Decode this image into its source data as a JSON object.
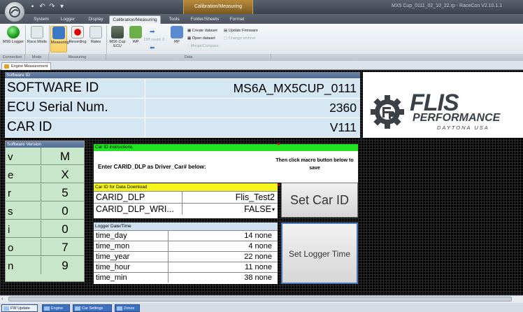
{
  "window": {
    "title": "MX5 Cup_0111_02_10_22.rp - RaceCon V2.10.1.1",
    "context_tab_caption": "Calibration/Measuring"
  },
  "ribbon": {
    "tabs": [
      {
        "label": "System",
        "active": false
      },
      {
        "label": "Logger",
        "active": false
      },
      {
        "label": "Display",
        "active": false
      },
      {
        "label": "Calibration/Measuring",
        "active": true
      },
      {
        "label": "Tools",
        "active": false
      },
      {
        "label": "Folder/Sheets",
        "active": false
      },
      {
        "label": "Format",
        "active": false
      }
    ],
    "buttons": {
      "ms6_logger": "MS6 Logger",
      "race_mode": "Race Mode",
      "measuring": "Measuring",
      "recording": "Recording",
      "rates": "Rates",
      "ms6_cup_ecu": "MS6 Cup ECU",
      "wp": "WP",
      "diff_count": "Diff count: 0",
      "rp": "RP",
      "create_dataset": "Create dataset",
      "update_firmware": "Update Firmware",
      "open_dataset": "Open dataset",
      "change_archive": "Change archive",
      "merge_compare": "Merge/Compare"
    },
    "groups": {
      "connection": "Connection",
      "mode": "Mode",
      "measuring": "Measuring",
      "data": "Data"
    }
  },
  "document_tab": "Engine Measurement",
  "software_id_panel": {
    "header": "Software ID",
    "rows": [
      {
        "label": "SOFTWARE ID",
        "value": "MS6A_MX5CUP_0111"
      },
      {
        "label": "ECU Serial Num.",
        "value": "2360"
      },
      {
        "label": "CAR ID",
        "value": "V111"
      }
    ]
  },
  "logo": {
    "name": "FLIS",
    "subtitle": "PERFORMANCE",
    "city": "DAYTONA USA",
    "colors": {
      "text": "#3a4046"
    }
  },
  "software_version_panel": {
    "header": "Software Version",
    "rows": [
      {
        "char": "v",
        "value": "M"
      },
      {
        "char": "e",
        "value": "X"
      },
      {
        "char": "r",
        "value": "5"
      },
      {
        "char": "s",
        "value": "0"
      },
      {
        "char": "i",
        "value": "0"
      },
      {
        "char": "o",
        "value": "7"
      },
      {
        "char": "n",
        "value": "9"
      }
    ]
  },
  "car_id_instructions": {
    "header": "Car ID instructions",
    "text": "Enter CARID_DLP as Driver_Car# below:",
    "note": "Then click macro button below to save",
    "header_color": "#21e321"
  },
  "car_id_download": {
    "header": "Car ID for Data Download",
    "header_color": "#f5f51b",
    "rows": [
      {
        "key": "CARID_DLP",
        "value": "Flis_Test2"
      },
      {
        "key": "CARID_DLP_WRI...",
        "value": "FALSE"
      }
    ]
  },
  "buttons": {
    "set_car_id": "Set Car ID",
    "set_logger_time": "Set Logger Time"
  },
  "logger_datetime": {
    "header": "Logger Date/Time",
    "rows": [
      {
        "key": "time_day",
        "value": "14 none"
      },
      {
        "key": "time_mon",
        "value": "4 none"
      },
      {
        "key": "time_year",
        "value": "22 none"
      },
      {
        "key": "time_hour",
        "value": "11 none"
      },
      {
        "key": "time_min",
        "value": "38 none"
      }
    ]
  },
  "sheet_tabs": [
    {
      "label": "FW Update",
      "active": true
    },
    {
      "label": "Engine",
      "active": false
    },
    {
      "label": "Car Settings",
      "active": false
    },
    {
      "label": "Zones",
      "active": false
    }
  ]
}
